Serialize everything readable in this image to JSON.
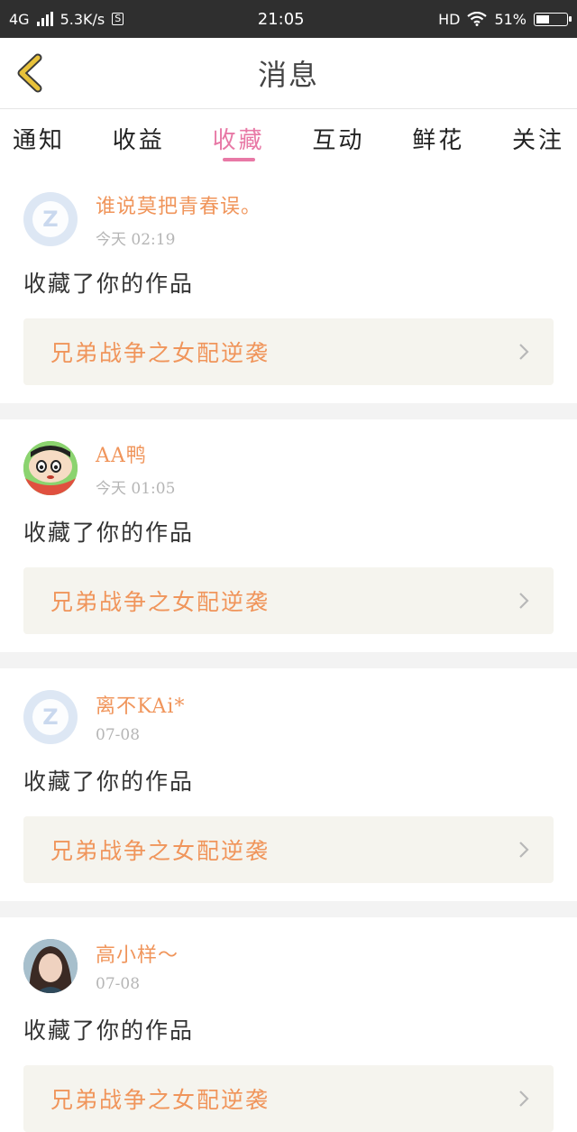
{
  "status_bar": {
    "network": "4G",
    "speed": "5.3K/s",
    "s_badge": "S",
    "time": "21:05",
    "hd": "HD",
    "battery": "51%",
    "battery_level": 0.51
  },
  "header": {
    "title": "消息",
    "back_icon": "chevron-left-icon"
  },
  "tabs": [
    {
      "label": "通知"
    },
    {
      "label": "收益"
    },
    {
      "label": "收藏",
      "active": true
    },
    {
      "label": "互动"
    },
    {
      "label": "鲜花"
    },
    {
      "label": "关注"
    }
  ],
  "feed": [
    {
      "user": "谁说莫把青春误。",
      "time": "今天 02:19",
      "action": "收藏了你的作品",
      "work": "兄弟战争之女配逆袭",
      "avatar": "default-avatar-icon"
    },
    {
      "user": "AA鸭",
      "time": "今天 01:05",
      "action": "收藏了你的作品",
      "work": "兄弟战争之女配逆袭",
      "avatar": "cartoon-avatar-icon"
    },
    {
      "user": "离不KAi*",
      "time": "07-08",
      "action": "收藏了你的作品",
      "work": "兄弟战争之女配逆袭",
      "avatar": "default-avatar-icon"
    },
    {
      "user": "高小样～",
      "time": "07-08",
      "action": "收藏了你的作品",
      "work": "兄弟战争之女配逆袭",
      "avatar": "photo-avatar-icon"
    }
  ],
  "colors": {
    "accent": "#e879a6",
    "username": "#f0955b",
    "work_bg": "#f5f4ee",
    "back_icon": "#e8c23a"
  }
}
